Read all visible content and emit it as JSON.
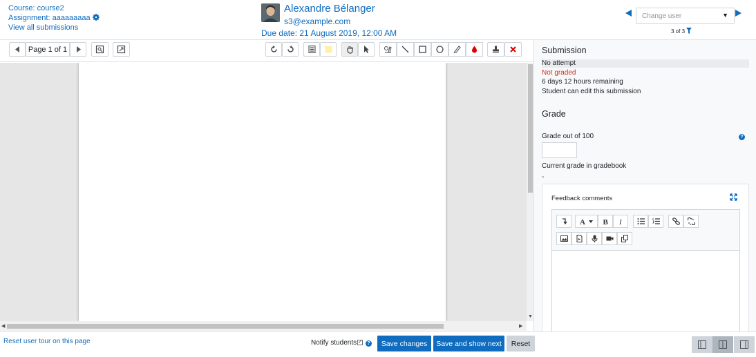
{
  "header": {
    "course_link": "Course: course2",
    "assignment_link": "Assignment: aaaaaaaaa",
    "view_all_link": "View all submissions",
    "user_name": "Alexandre Bélanger",
    "user_email": "s3@example.com",
    "due_date": "Due date: 21 August 2019, 12:00 AM",
    "change_user_placeholder": "Change user",
    "user_count": "3 of 3"
  },
  "toolbar": {
    "page_label": "Page 1 of 1"
  },
  "panel": {
    "submission_heading": "Submission",
    "status_attempt": "No attempt",
    "status_grading": "Not graded",
    "time_remaining": "6 days 12 hours remaining",
    "edit_status": "Student can edit this submission",
    "grade_heading": "Grade",
    "grade_out_of": "Grade out of 100",
    "current_grade_label": "Current grade in gradebook",
    "current_grade_value": "-",
    "feedback_title": "Feedback comments"
  },
  "footer": {
    "reset_tour_link": "Reset user tour on this page",
    "notify_label": "Notify students",
    "save_changes": "Save changes",
    "save_and_next": "Save and show next",
    "reset": "Reset"
  },
  "colors": {
    "accent": "#0f6cbf",
    "not_graded": "#ca3120",
    "delete": "#e00000"
  }
}
